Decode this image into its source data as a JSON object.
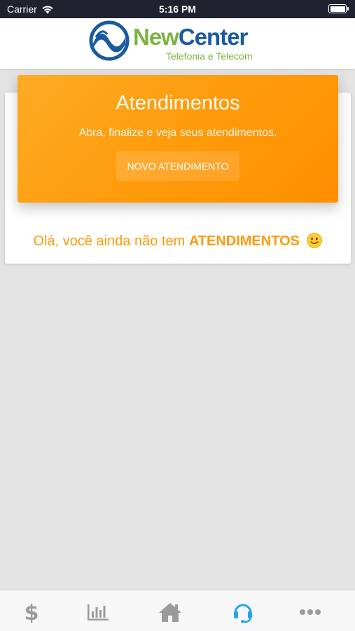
{
  "status_bar": {
    "carrier": "Carrier",
    "time": "5:16 PM"
  },
  "header": {
    "logo_brand_part1": "New",
    "logo_brand_part2": "Center",
    "logo_tagline": "Telefonia e Telecom"
  },
  "banner": {
    "title": "Atendimentos",
    "subtitle": "Abra, finalize e veja seus atendimentos.",
    "button_label": "NOVO ATENDIMENTO"
  },
  "empty_state": {
    "text": "Olá, você ainda não tem",
    "highlight": "ATENDIMENTOS"
  },
  "tabbar": {
    "tabs": [
      {
        "icon": "dollar-icon",
        "active": false
      },
      {
        "icon": "bar-chart-icon",
        "active": false
      },
      {
        "icon": "home-icon",
        "active": false
      },
      {
        "icon": "headset-icon",
        "active": true
      },
      {
        "icon": "more-icon",
        "active": false
      }
    ]
  },
  "colors": {
    "accent": "#ff9a0a",
    "active_tab": "#1ea7f0",
    "inactive_tab": "#9b9b9b",
    "brand_green": "#7ab341",
    "brand_blue": "#1a5aa0"
  }
}
